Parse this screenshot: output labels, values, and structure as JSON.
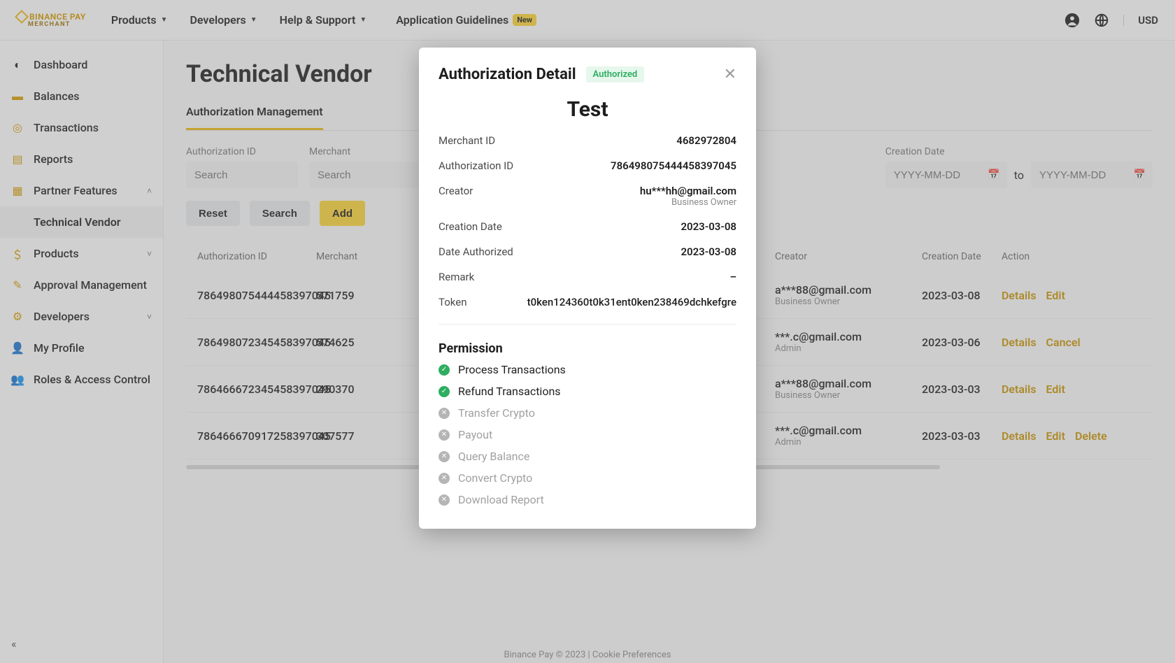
{
  "topnav": {
    "logo_line1": "BINANCE PAY",
    "logo_line2": "MERCHANT",
    "items": [
      "Products",
      "Developers",
      "Help & Support"
    ],
    "app_guidelines": "Application Guidelines",
    "badge_new": "New",
    "currency": "USD"
  },
  "sidebar": {
    "items": [
      {
        "label": "Dashboard"
      },
      {
        "label": "Balances"
      },
      {
        "label": "Transactions"
      },
      {
        "label": "Reports"
      },
      {
        "label": "Partner Features",
        "expandable": true,
        "expanded": true
      },
      {
        "label": "Products",
        "expandable": true
      },
      {
        "label": "Approval Management"
      },
      {
        "label": "Developers",
        "expandable": true
      },
      {
        "label": "My Profile"
      },
      {
        "label": "Roles & Access Control"
      }
    ],
    "sub_item": "Technical Vendor"
  },
  "page": {
    "title": "Technical Vendor",
    "tab": "Authorization Management",
    "filters": {
      "auth_label": "Authorization ID",
      "merch_label": "Merchant",
      "date_label": "Creation Date",
      "placeholder": "Search",
      "date_placeholder": "YYYY-MM-DD",
      "to": "to"
    },
    "buttons": {
      "reset": "Reset",
      "search": "Search",
      "add": "Add"
    },
    "columns": {
      "auth": "Authorization ID",
      "merch": "Merchant",
      "creator": "Creator",
      "date": "Creation Date",
      "action": "Action"
    },
    "rows": [
      {
        "auth": "786498075444458397045",
        "merch": "571759",
        "creator": "a***88@gmail.com",
        "role": "Business Owner",
        "date": "2023-03-08",
        "actions": [
          "Details",
          "Edit"
        ]
      },
      {
        "auth": "786498072345458397045",
        "merch": "574625",
        "creator": "***.c@gmail.com",
        "role": "Admin",
        "date": "2023-03-06",
        "actions": [
          "Details",
          "Cancel"
        ]
      },
      {
        "auth": "786466672345458397045",
        "merch": "290370",
        "creator": "a***88@gmail.com",
        "role": "Business Owner",
        "date": "2023-03-03",
        "actions": [
          "Details",
          "Edit"
        ]
      },
      {
        "auth": "786466670917258397045",
        "merch": "307577",
        "creator": "***.c@gmail.com",
        "role": "Admin",
        "date": "2023-03-03",
        "actions": [
          "Details",
          "Edit",
          "Delete"
        ]
      }
    ]
  },
  "footer": "Binance Pay © 2023 | Cookie Preferences",
  "modal": {
    "title": "Authorization Detail",
    "status": "Authorized",
    "name": "Test",
    "fields": {
      "merchant_id_l": "Merchant ID",
      "merchant_id": "4682972804",
      "auth_id_l": "Authorization ID",
      "auth_id": "786498075444458397045",
      "creator_l": "Creator",
      "creator": "hu***hh@gmail.com",
      "creator_role": "Business Owner",
      "creation_l": "Creation Date",
      "creation": "2023-03-08",
      "authorized_l": "Date Authorized",
      "authorized": "2023-03-08",
      "remark_l": "Remark",
      "remark": "–",
      "token_l": "Token",
      "token": "t0ken124360t0k31ent0ken238469dchkefgre"
    },
    "perm_title": "Permission",
    "permissions": [
      {
        "label": "Process Transactions",
        "on": true
      },
      {
        "label": "Refund Transactions",
        "on": true
      },
      {
        "label": "Transfer Crypto",
        "on": false
      },
      {
        "label": "Payout",
        "on": false
      },
      {
        "label": "Query Balance",
        "on": false
      },
      {
        "label": "Convert Crypto",
        "on": false
      },
      {
        "label": "Download Report",
        "on": false
      }
    ]
  }
}
